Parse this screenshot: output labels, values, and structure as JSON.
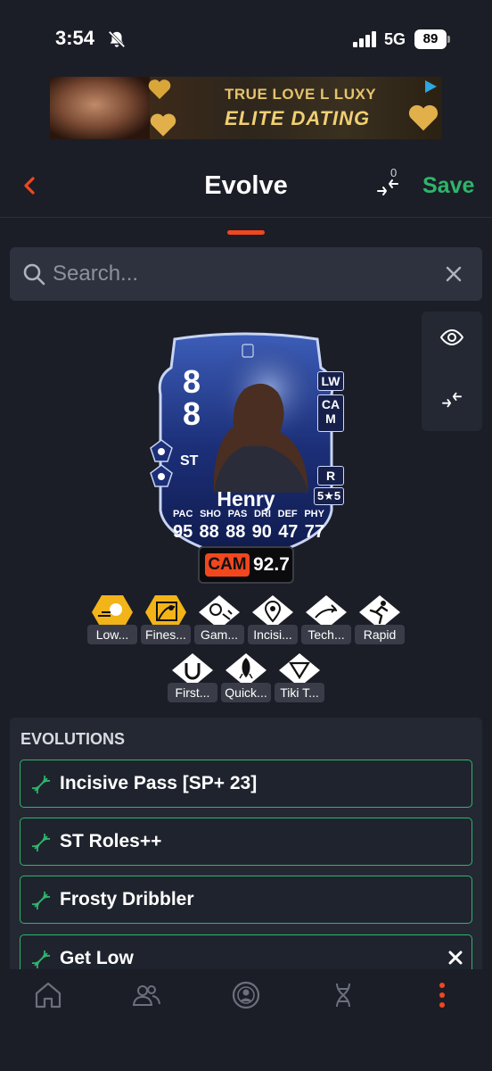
{
  "status_bar": {
    "time": "3:54",
    "network": "5G",
    "battery": "89"
  },
  "ad": {
    "line1": "TRUE LOVE  L  LUXY",
    "line2": "ELITE DATING"
  },
  "header": {
    "title": "Evolve",
    "compare_count": "0",
    "save_label": "Save"
  },
  "search": {
    "placeholder": "Search..."
  },
  "card": {
    "rating": [
      "8",
      "8"
    ],
    "position": "ST",
    "alt_positions": [
      "LW",
      "CA\nM"
    ],
    "foot": "R",
    "skill_weak": "5★5",
    "name": "Henry",
    "stats": [
      {
        "label": "PAC",
        "value": "95"
      },
      {
        "label": "SHO",
        "value": "88"
      },
      {
        "label": "PAS",
        "value": "88"
      },
      {
        "label": "DRI",
        "value": "90"
      },
      {
        "label": "DEF",
        "value": "47"
      },
      {
        "label": "PHY",
        "value": "77"
      }
    ],
    "role_label": "CAM",
    "role_rating": "92.7"
  },
  "playstyles": [
    {
      "label": "Low...",
      "plus": true,
      "icon": "low-driven-shot-icon"
    },
    {
      "label": "Fines...",
      "plus": true,
      "icon": "finesse-shot-icon"
    },
    {
      "label": "Gam...",
      "plus": false,
      "icon": "game-changer-icon"
    },
    {
      "label": "Incisi...",
      "plus": false,
      "icon": "incisive-pass-icon"
    },
    {
      "label": "Tech...",
      "plus": false,
      "icon": "technical-icon"
    },
    {
      "label": "Rapid",
      "plus": false,
      "icon": "rapid-icon"
    },
    {
      "label": "First...",
      "plus": false,
      "icon": "first-touch-icon"
    },
    {
      "label": "Quick...",
      "plus": false,
      "icon": "quick-step-icon"
    },
    {
      "label": "Tiki T...",
      "plus": false,
      "icon": "tiki-taka-icon"
    }
  ],
  "evolutions": {
    "heading": "EVOLUTIONS",
    "items": [
      {
        "name": "Incisive Pass [SP+ 23]",
        "removable": false
      },
      {
        "name": "ST Roles++",
        "removable": false
      },
      {
        "name": "Frosty Dribbler",
        "removable": false
      },
      {
        "name": "Get Low",
        "removable": true
      }
    ]
  },
  "nav": {
    "items": [
      "home-icon",
      "squad-icon",
      "player-icon",
      "evolution-icon",
      "more-icon"
    ]
  },
  "colors": {
    "accent": "#f0471f",
    "save": "#2fb56b",
    "background": "#1b1e27",
    "panel": "#242833"
  }
}
